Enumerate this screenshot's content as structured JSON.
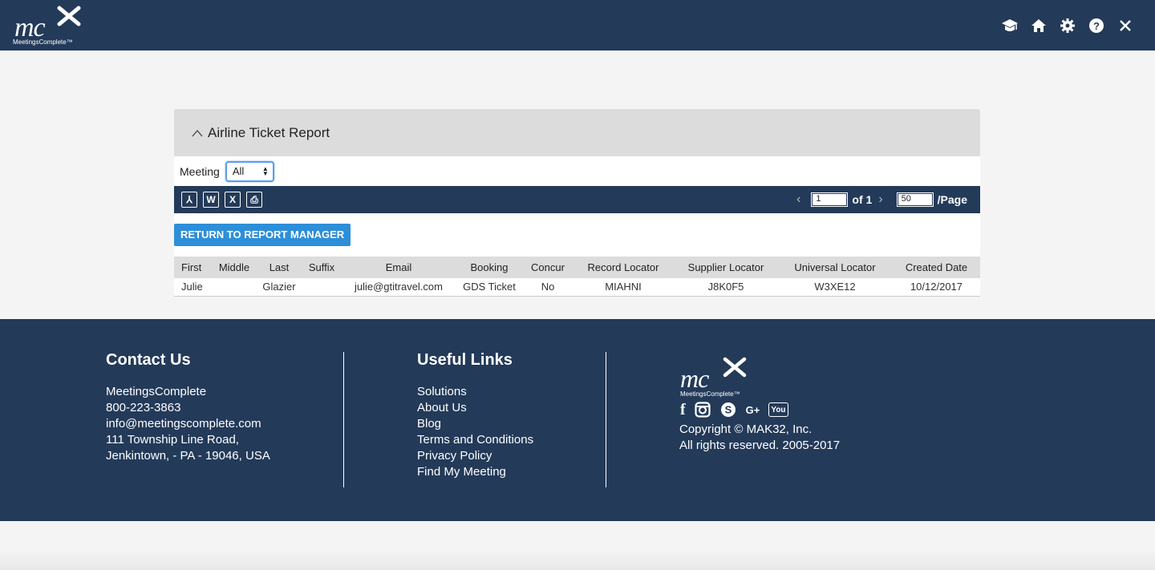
{
  "header": {
    "logo_text": "mc",
    "logo_brand": "MeetingsComplete™",
    "icons": [
      "graduation-cap-icon",
      "home-icon",
      "gear-icon",
      "help-icon",
      "close-icon"
    ]
  },
  "panel": {
    "title": "Airline Ticket Report",
    "filter_label": "Meeting",
    "filter_value": "All",
    "export_icons": [
      "pdf-icon",
      "word-icon",
      "excel-icon",
      "print-icon"
    ],
    "export_glyphs": [
      "⅄",
      "W",
      "X",
      "⎙"
    ],
    "pager": {
      "prev": "‹",
      "page": "1",
      "of_label": "of 1",
      "next": "›",
      "per_page": "50",
      "per_page_label": "/Page"
    },
    "return_button": "RETURN TO REPORT MANAGER"
  },
  "table": {
    "columns": [
      "First",
      "Middle",
      "Last",
      "Suffix",
      "Email",
      "Booking",
      "Concur",
      "Record Locator",
      "Supplier Locator",
      "Universal Locator",
      "Created Date"
    ],
    "rows": [
      [
        "Julie",
        "",
        "Glazier",
        "",
        "julie@gtitravel.com",
        "GDS Ticket",
        "No",
        "MIAHNI",
        "J8K0F5",
        "W3XE12",
        "10/12/2017"
      ]
    ]
  },
  "footer": {
    "contact": {
      "title": "Contact Us",
      "lines": [
        "MeetingsComplete",
        "800-223-3863",
        "info@meetingscomplete.com",
        "111 Township Line Road,",
        "Jenkintown, - PA - 19046, USA"
      ]
    },
    "links": {
      "title": "Useful Links",
      "items": [
        "Solutions",
        "About Us",
        "Blog",
        "Terms and Conditions",
        "Privacy Policy",
        "Find My Meeting"
      ]
    },
    "logo_text": "mc",
    "logo_brand": "MeetingsComplete™",
    "social": [
      {
        "icon": "facebook-icon",
        "glyph": "f"
      },
      {
        "icon": "instagram-icon",
        "glyph": "◙"
      },
      {
        "icon": "skype-icon",
        "glyph": "S"
      },
      {
        "icon": "google-plus-icon",
        "glyph": "G+"
      },
      {
        "icon": "youtube-icon",
        "glyph": "You"
      }
    ],
    "copyright": [
      "Copyright © MAK32, Inc.",
      "All rights reserved. 2005-2017"
    ]
  },
  "colors": {
    "navy": "#233a59",
    "button_blue": "#2d8fd8",
    "panel_gray": "#dcdcdc"
  }
}
